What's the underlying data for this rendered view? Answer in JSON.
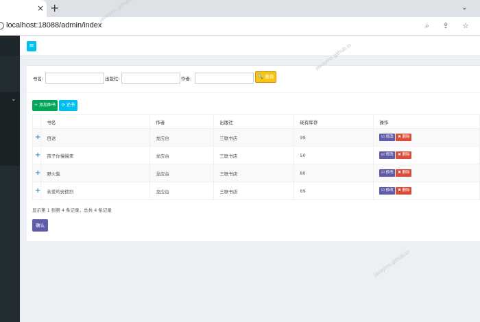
{
  "browser": {
    "tab_close": "×",
    "new_tab": "+",
    "tab_menu": "⌄",
    "url": "localhost:18088/admin/index",
    "addr_icons": "⌕ ⇪ ☆"
  },
  "sidebar": {
    "chevron": "⌄"
  },
  "header": {
    "toggle": "≡"
  },
  "search": {
    "title_label": "书名:",
    "publisher_label": "出版社:",
    "author_label": "作者:",
    "button": "🔍 查询"
  },
  "toolbar": {
    "add": "+ 添加图书",
    "refresh": "⟳ 还书"
  },
  "table": {
    "headers": [
      "",
      "书名",
      "作者",
      "出版社",
      "现有库存",
      "操作"
    ],
    "rows": [
      {
        "name": "目送",
        "author": "龙应台",
        "publisher": "三联书店",
        "stock": "99"
      },
      {
        "name": "孩子你慢慢来",
        "author": "龙应台",
        "publisher": "三联书店",
        "stock": "50"
      },
      {
        "name": "野火集",
        "author": "龙应台",
        "publisher": "三联书店",
        "stock": "80"
      },
      {
        "name": "亲爱的安德烈",
        "author": "龙应台",
        "publisher": "三联书店",
        "stock": "89"
      }
    ],
    "plus": "+",
    "edit_label": "☑ 修改",
    "delete_label": "✖ 删除"
  },
  "footer": {
    "info": "显示第 1 到第 4 条记录，总共 4 条记录",
    "confirm": "确认"
  },
  "watermark": "javayms.github.io",
  "colors": {
    "sidebar": "#222d32",
    "toggle": "#00c0ef",
    "search_button": "#f5c518",
    "add_button": "#00a65a",
    "edit_button": "#605ca8",
    "delete_button": "#dd4b39"
  }
}
